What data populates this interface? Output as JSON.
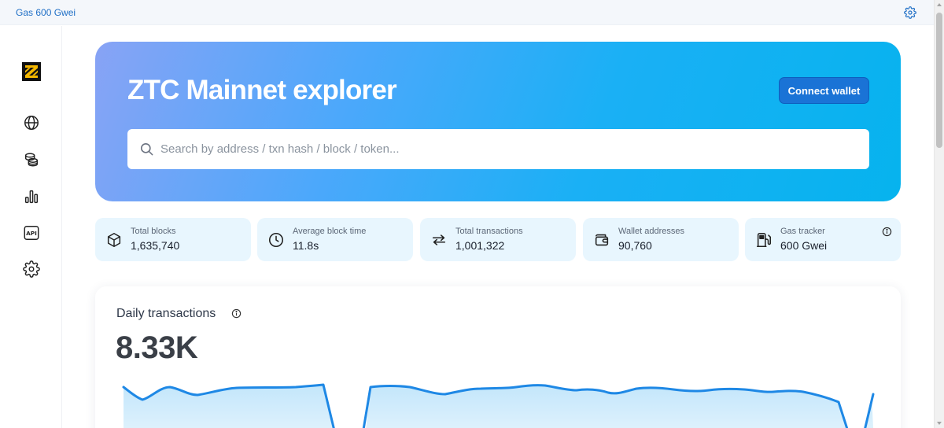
{
  "topbar": {
    "gas_label": "Gas 600 Gwei",
    "settings_icon": "gear-icon"
  },
  "sidebar": {
    "logo": "ztc-logo",
    "items": [
      {
        "name": "globe-icon",
        "label": "Explorer"
      },
      {
        "name": "coins-icon",
        "label": "Tokens"
      },
      {
        "name": "chart-icon",
        "label": "Charts"
      },
      {
        "name": "api-icon",
        "label": "API"
      },
      {
        "name": "gear-icon",
        "label": "Settings"
      }
    ]
  },
  "hero": {
    "title": "ZTC Mainnet explorer",
    "connect_label": "Connect wallet",
    "search_placeholder": "Search by address / txn hash / block / token..."
  },
  "stats": [
    {
      "label": "Total blocks",
      "value": "1,635,740",
      "icon": "cube-icon"
    },
    {
      "label": "Average block time",
      "value": "11.8s",
      "icon": "clock-icon"
    },
    {
      "label": "Total transactions",
      "value": "1,001,322",
      "icon": "arrows-icon"
    },
    {
      "label": "Wallet addresses",
      "value": "90,760",
      "icon": "wallet-icon"
    },
    {
      "label": "Gas tracker",
      "value": "600 Gwei",
      "icon": "gas-pump-icon",
      "has_info": true
    }
  ],
  "daily": {
    "title": "Daily transactions",
    "value": "8.33K",
    "line_color": "#1e88e5",
    "fill_color": "#c7e8fb"
  },
  "colors": {
    "accent": "#1a73d6",
    "stat_bg": "#e8f6fe",
    "topbar_text": "#1f6fc6"
  }
}
